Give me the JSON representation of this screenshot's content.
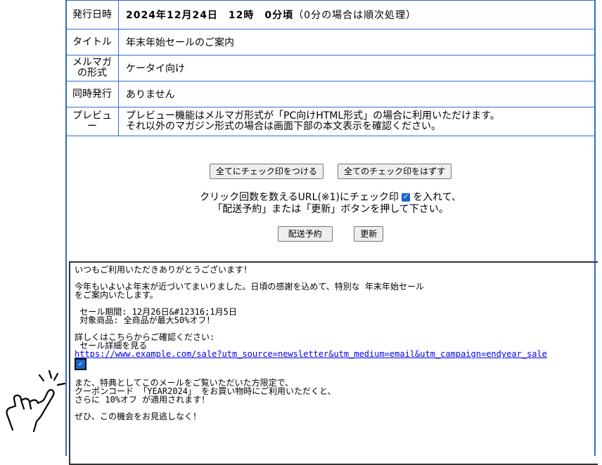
{
  "info_table": {
    "rows": [
      {
        "label": "発行日時",
        "value": "2024年12月24日　12時　0分頃",
        "note": "（0分の場合は順次処理）"
      },
      {
        "label": "タイトル",
        "value": "年末年始セールのご案内"
      },
      {
        "label": "メルマガの形式",
        "value": "ケータイ向け"
      },
      {
        "label": "同時発行",
        "value": "ありません"
      },
      {
        "label": "プレビュー",
        "value_lines": [
          "プレビュー機能はメルマガ形式が「PC向けHTML形式」の場合に利用いただけます。",
          "それ以外のマガジン形式の場合は画面下部の本文表示を確認ください。"
        ]
      }
    ]
  },
  "buttons": {
    "check_all": "全てにチェック印をつける",
    "uncheck_all": "全てのチェック印をはずす",
    "send_reserve": "配送予約",
    "update": "更新"
  },
  "instructions": {
    "line1_before": "クリック回数を数えるURL(※1)にチェック印",
    "line1_after": "を入れて、",
    "line2": "「配送予約」または「更新」ボタンを押して下さい。"
  },
  "email_body": {
    "greeting": "いつもご利用いただきありがとうございます！",
    "para1_l1": "今年もいよいよ年末が近づいてまいりました。日頃の感謝を込めて、特別な 年末年始セール",
    "para1_l2": "をご案内いたします。",
    "sale_period": " セール期間: 12月26日&#12316;1月5日",
    "sale_items": " 対象商品: 全商品が最大50%オフ！",
    "details_l1": "詳しくはこちらからご確認ください:",
    "details_l2": " セール詳細を見る",
    "url": "https://www.example.com/sale?utm_source=newsletter&utm_medium=email&utm_campaign=endyear_sale",
    "url_checked": true,
    "para2_l1": "また、特典としてこのメールをご覧いただいた方限定で、",
    "para2_l2": "クーポンコード 「YEAR2024」 をお買い物時にご利用いただくと、",
    "para2_l3": "さらに 10%オフ が適用されます！",
    "closing": "ぜひ、この機会をお見逃しなく！"
  },
  "colors": {
    "table_border": "#2e6ec8",
    "checkbox": "#1a66d2",
    "link": "#0000ee"
  },
  "icons": {
    "hand": "pointing-hand-icon",
    "check": "checkmark-icon"
  }
}
